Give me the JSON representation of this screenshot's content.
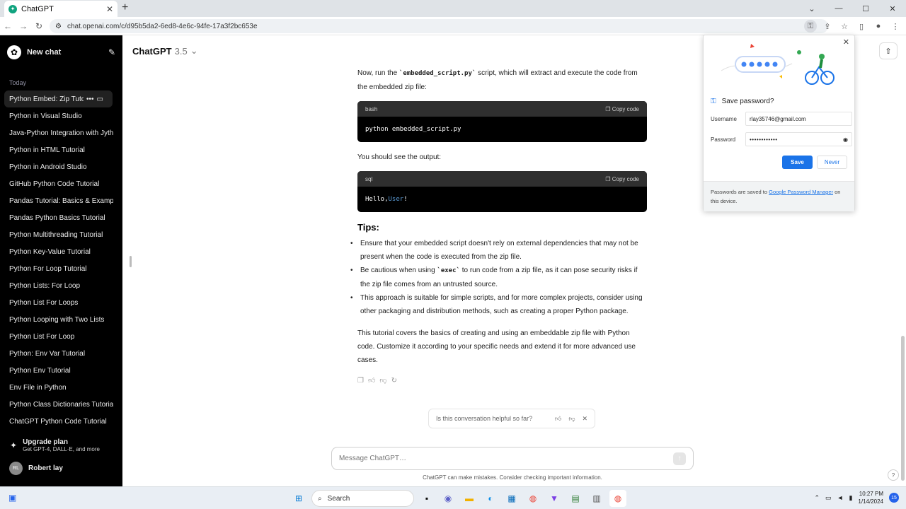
{
  "browser": {
    "tab_title": "ChatGPT",
    "new_tab_label": "+",
    "url": "chat.openai.com/c/d95b5da2-6ed8-4e6c-94fe-17a3f2bc653e"
  },
  "sidebar": {
    "new_chat_label": "New chat",
    "section_label": "Today",
    "items": [
      "Python Embed: Zip Tutoria",
      "Python in Visual Studio",
      "Java-Python Integration with Jyth",
      "Python in HTML Tutorial",
      "Python in Android Studio",
      "GitHub Python Code Tutorial",
      "Pandas Tutorial: Basics & Exampl",
      "Pandas Python Basics Tutorial",
      "Python Multithreading Tutorial",
      "Python Key-Value Tutorial",
      "Python For Loop Tutorial",
      "Python Lists: For Loop",
      "Python List For Loops",
      "Python Looping with Two Lists",
      "Python List For Loop",
      "Python: Env Var Tutorial",
      "Python Env Tutorial",
      "Env File in Python",
      "Python Class Dictionaries Tutoria",
      "ChatGPT Python Code Tutorial"
    ],
    "upgrade_title": "Upgrade plan",
    "upgrade_sub": "Get GPT-4, DALL·E, and more",
    "user_initials": "RL",
    "user_name": "Robert lay"
  },
  "main": {
    "model_name": "ChatGPT",
    "model_version": "3.5",
    "para1_pre": "Now, run the ",
    "para1_code": "`embedded_script.py`",
    "para1_post": " script, which will extract and execute the code from the embedded zip file:",
    "code1_lang": "bash",
    "copy_label": "Copy code",
    "code1_text": "python embedded_script.py",
    "para2": "You should see the output:",
    "code2_lang": "sql",
    "code2_pre": "Hello, ",
    "code2_hl": "User",
    "code2_post": "!",
    "tips_heading": "Tips:",
    "tip1": "Ensure that your embedded script doesn't rely on external dependencies that may not be present when the code is executed from the zip file.",
    "tip2_pre": "Be cautious when using ",
    "tip2_code": "`exec`",
    "tip2_post": " to run code from a zip file, as it can pose security risks if the zip file comes from an untrusted source.",
    "tip3": "This approach is suitable for simple scripts, and for more complex projects, consider using other packaging and distribution methods, such as creating a proper Python package.",
    "closing": "This tutorial covers the basics of creating and using an embeddable zip file with Python code. Customize it according to your specific needs and extend it for more advanced use cases.",
    "helpful_question": "Is this conversation helpful so far?",
    "composer_placeholder": "Message ChatGPT…",
    "disclaimer": "ChatGPT can make mistakes. Consider checking important information.",
    "help_label": "?"
  },
  "password_popup": {
    "title": "Save password?",
    "username_label": "Username",
    "username_value": "rlay35746@gmail.com",
    "password_label": "Password",
    "password_value": "••••••••••••",
    "save_label": "Save",
    "never_label": "Never",
    "footer_pre": "Passwords are saved to ",
    "footer_link": "Google Password Manager",
    "footer_post": " on this device."
  },
  "taskbar": {
    "search_label": "Search",
    "time": "10:27 PM",
    "date": "1/14/2024",
    "notif_count": "15"
  },
  "colors": {
    "sidebar_bg": "#000000",
    "accent_blue": "#1a73e8",
    "code_header": "#2f2f2f"
  }
}
